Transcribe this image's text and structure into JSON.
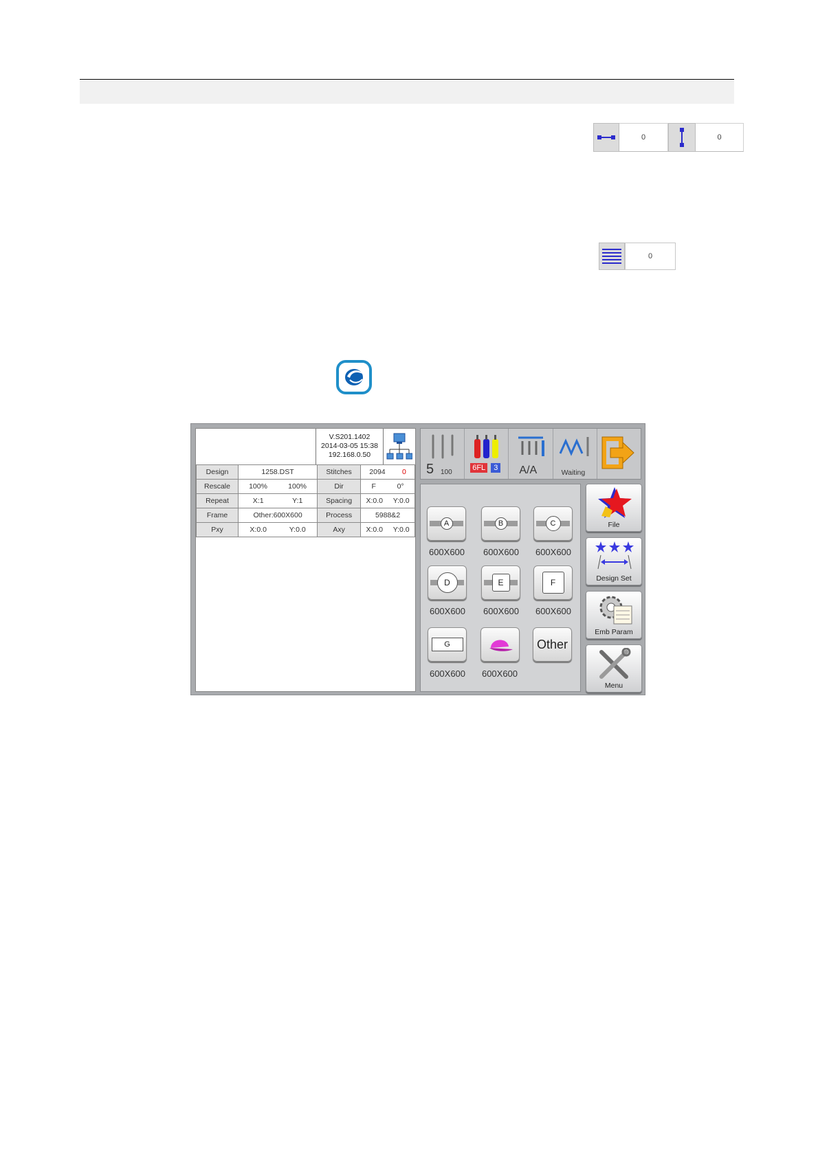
{
  "offsets": {
    "horizontal_value": "0",
    "vertical_value": "0",
    "lines_value": "0"
  },
  "screen": {
    "version": "V.S201.1402",
    "datetime": "2014-03-05 15:38",
    "ip": "192.168.0.50",
    "info_rows": [
      {
        "label": "Design",
        "value_a": "1258.DST",
        "value_b": "",
        "label2": "Stitches",
        "value2_a": "2094",
        "value2_b": "0"
      },
      {
        "label": "Rescale",
        "value_a": "100%",
        "value_b": "100%",
        "label2": "Dir",
        "value2_a": "F",
        "value2_b": "0°"
      },
      {
        "label": "Repeat",
        "value_a": "X:1",
        "value_b": "Y:1",
        "label2": "Spacing",
        "value2_a": "X:0.0",
        "value2_b": "Y:0.0"
      },
      {
        "label": "Frame",
        "value_a": "Other:600X600",
        "value_b": "",
        "label2": "Process",
        "value2_a": "5988&2",
        "value2_b": ""
      },
      {
        "label": "Pxy",
        "value_a": "X:0.0",
        "value_b": "Y:0.0",
        "label2": "Axy",
        "value2_a": "X:0.0",
        "value2_b": "Y:0.0"
      }
    ],
    "status": {
      "needle": "5",
      "speed": "100",
      "color_code": "6FL",
      "color_num": "3",
      "mode": "A/A",
      "state": "Waiting"
    },
    "frames": [
      {
        "letter": "A",
        "size": "600X600"
      },
      {
        "letter": "B",
        "size": "600X600"
      },
      {
        "letter": "C",
        "size": "600X600"
      },
      {
        "letter": "D",
        "size": "600X600"
      },
      {
        "letter": "E",
        "size": "600X600"
      },
      {
        "letter": "F",
        "size": "600X600"
      },
      {
        "letter": "G",
        "size": "600X600"
      },
      {
        "letter": "",
        "size": "600X600"
      }
    ],
    "other_label": "Other",
    "side_buttons": [
      "File",
      "Design Set",
      "Emb Param",
      "Menu"
    ],
    "colors": {
      "accent_blue": "#3a3ae0",
      "red_tag": "#e0343a",
      "blue_tag": "#3b5bd6"
    }
  }
}
